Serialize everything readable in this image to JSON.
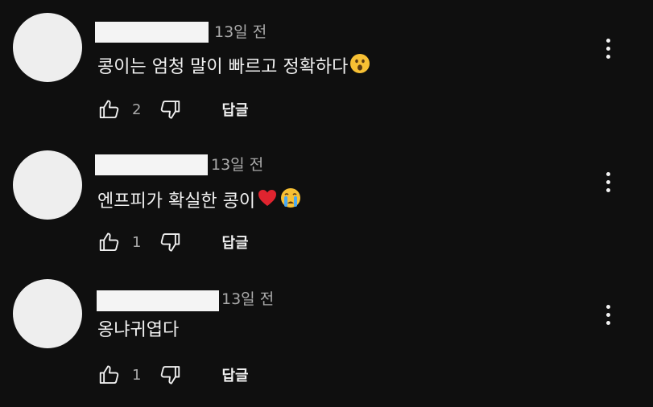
{
  "comments": [
    {
      "timestamp": "13일 전",
      "text": "콩이는 엄청 말이 빠르고 정확하다",
      "emoji": "astonished-face",
      "likes": "2",
      "reply_label": "답글"
    },
    {
      "timestamp": "13일 전",
      "text": "엔프피가 확실한 콩이",
      "emoji": "heart-and-crying-face",
      "likes": "1",
      "reply_label": "답글"
    },
    {
      "timestamp": "13일 전",
      "text": "옹냐귀엽다",
      "emoji": "",
      "likes": "1",
      "reply_label": "답글"
    }
  ],
  "colors": {
    "background": "#0f0f0f",
    "text": "#f1f1f1",
    "secondary_text": "#aaaaaa",
    "placeholder": "#eeeeee"
  },
  "icons": [
    "thumbs-up-icon",
    "thumbs-down-icon",
    "more-vert-icon",
    "astonished-face-emoji",
    "red-heart-emoji",
    "crying-face-emoji"
  ]
}
